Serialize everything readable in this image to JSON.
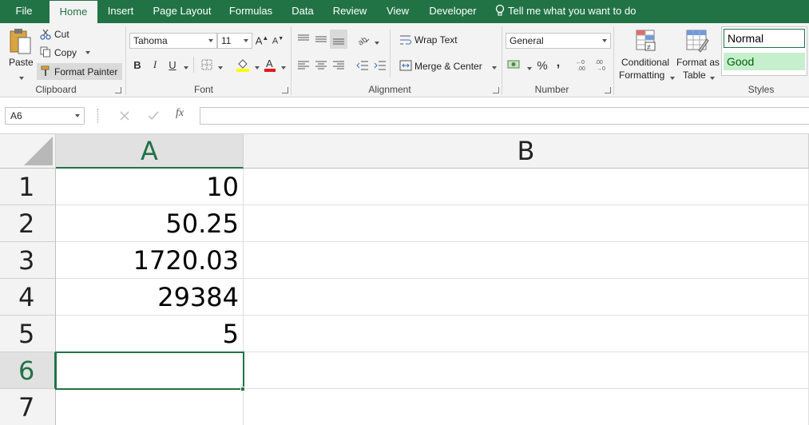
{
  "tabs": [
    "File",
    "Home",
    "Insert",
    "Page Layout",
    "Formulas",
    "Data",
    "Review",
    "View",
    "Developer"
  ],
  "tell_me": "Tell me what you want to do",
  "clipboard": {
    "paste": "Paste",
    "cut": "Cut",
    "copy": "Copy",
    "format_painter": "Format Painter",
    "label": "Clipboard"
  },
  "font": {
    "name": "Tahoma",
    "size": "11",
    "label": "Font",
    "bold": "B",
    "italic": "I",
    "underline": "U"
  },
  "alignment": {
    "wrap_text": "Wrap Text",
    "merge_center": "Merge & Center",
    "label": "Alignment"
  },
  "number": {
    "format": "General",
    "percent": "%",
    "comma": ",",
    "label": "Number"
  },
  "styles": {
    "conditional": "Conditional",
    "formatting": "Formatting",
    "format_as": "Format as",
    "table": "Table",
    "normal": "Normal",
    "good": "Good",
    "label": "Styles"
  },
  "formula_bar": {
    "name_box": "A6",
    "fx": "fx",
    "formula": ""
  },
  "sheet": {
    "columns": [
      "A",
      "B"
    ],
    "rows": [
      "1",
      "2",
      "3",
      "4",
      "5",
      "6",
      "7"
    ],
    "values": [
      "10",
      "50.25",
      "1720.03",
      "29384",
      "5",
      "",
      ""
    ]
  },
  "colors": {
    "accent": "#217346",
    "good_fill": "#c6efce",
    "good_text": "#006100"
  }
}
